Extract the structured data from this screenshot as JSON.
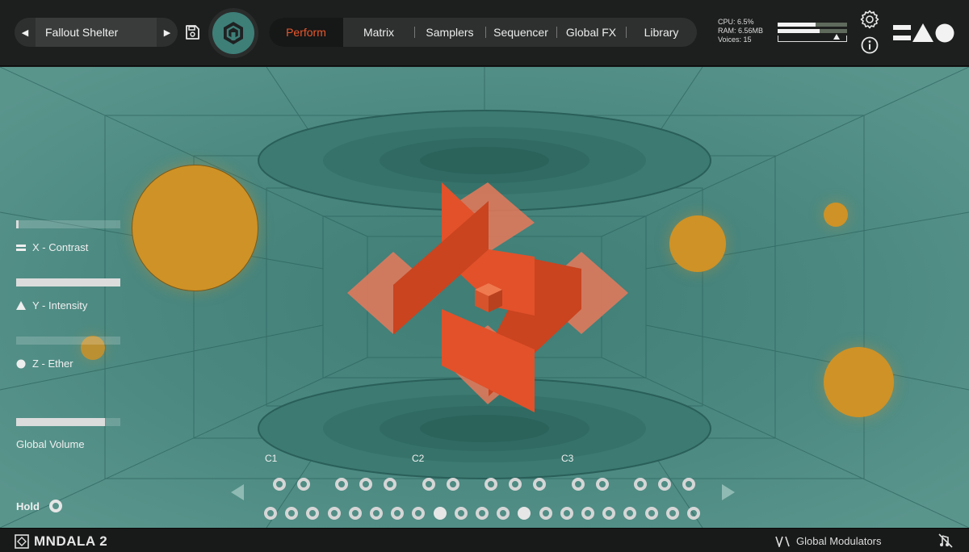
{
  "header": {
    "preset_name": "Fallout Shelter",
    "tabs": [
      {
        "label": "Perform",
        "active": true
      },
      {
        "label": "Matrix"
      },
      {
        "label": "Samplers"
      },
      {
        "label": "Sequencer"
      },
      {
        "label": "Global FX"
      },
      {
        "label": "Library"
      }
    ],
    "stats": {
      "cpu": "CPU: 6.5%",
      "ram": "RAM: 6.56MB",
      "voices": "Voices: 15"
    },
    "meters": {
      "left_level": 0.55,
      "right_level": 0.6
    },
    "icons": [
      "prev-icon",
      "next-icon",
      "save-icon",
      "mndala-logo-icon",
      "gear-icon",
      "info-icon",
      "brand-shapes-icon"
    ]
  },
  "controls": {
    "x": {
      "label": "X - Contrast",
      "level": 0.02
    },
    "y": {
      "label": "Y - Intensity",
      "level": 1.0
    },
    "z": {
      "label": "Z - Ether",
      "level": 0.0
    },
    "volume": {
      "label": "Global Volume",
      "level": 0.85
    },
    "hold": {
      "label": "Hold"
    }
  },
  "keyboard": {
    "octaves": [
      "C1",
      "C2",
      "C3"
    ],
    "active_keys": [
      8,
      12
    ]
  },
  "footer": {
    "brand": "MNDALA 2",
    "modulators_label": "Global Modulators"
  },
  "colors": {
    "accent": "#e8582d",
    "stage": "#4f8c83",
    "orb": "#cf9226",
    "mandala": "#e2512a"
  }
}
